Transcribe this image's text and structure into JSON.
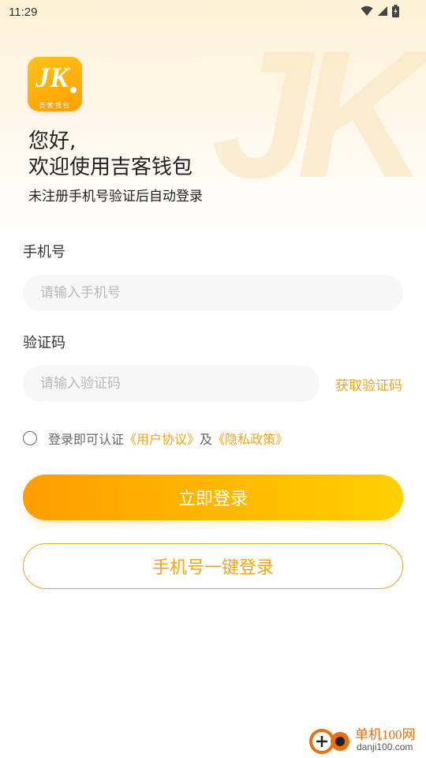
{
  "status_bar": {
    "time": "11:29"
  },
  "logo": {
    "mark": "JK",
    "subtitle": "吉客钱包"
  },
  "header": {
    "greeting_line1": "您好,",
    "greeting_line2": "欢迎使用吉客钱包",
    "subtitle": "未注册手机号验证后自动登录"
  },
  "form": {
    "phone_label": "手机号",
    "phone_placeholder": "请输入手机号",
    "phone_value": "",
    "code_label": "验证码",
    "code_placeholder": "请输入验证码",
    "code_value": "",
    "get_code_label": "获取验证码"
  },
  "agreement": {
    "prefix": "登录即可认证",
    "user_agreement": "《用户协议》",
    "and": "及",
    "privacy_policy": "《隐私政策》",
    "checked": false
  },
  "buttons": {
    "login": "立即登录",
    "one_click": "手机号一键登录"
  },
  "watermark": {
    "title": "单机100网",
    "url": "danji100.com"
  },
  "colors": {
    "accent": "#f2a51c",
    "gradient_start": "#ff9d00",
    "gradient_end": "#ffd000"
  },
  "icons": [
    "wifi-icon",
    "signal-icon",
    "battery-icon",
    "radio-icon"
  ]
}
